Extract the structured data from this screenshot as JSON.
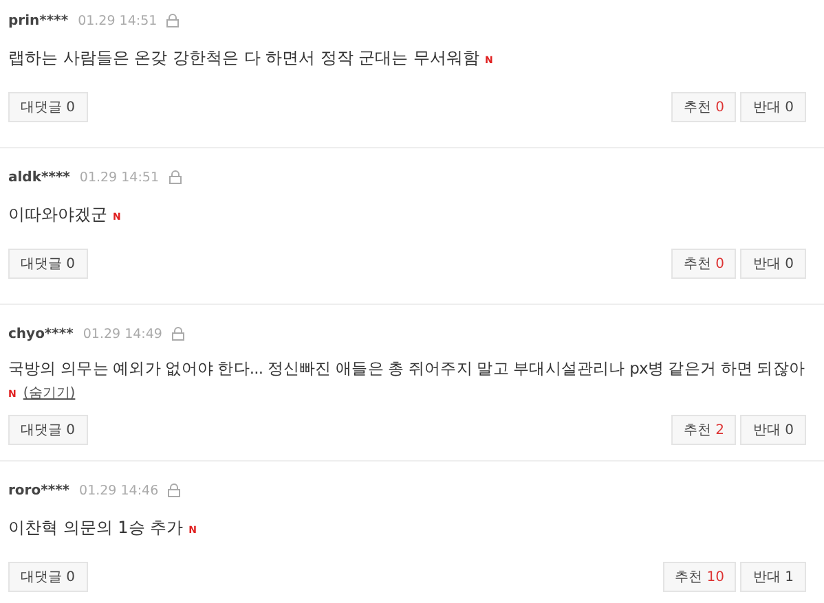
{
  "comments": [
    {
      "author": "prin****",
      "time": "01.29 14:51",
      "text": "랩하는 사람들은 온갖 강한척은 다 하면서 정작 군대는 무서워함",
      "new_badge": "N",
      "reply_label": "대댓글",
      "reply_count": "0",
      "up_label": "추천",
      "up_count": "0",
      "down_label": "반대",
      "down_count": "0"
    },
    {
      "author": "aldk****",
      "time": "01.29 14:51",
      "text": "이따와야겠군",
      "new_badge": "N",
      "reply_label": "대댓글",
      "reply_count": "0",
      "up_label": "추천",
      "up_count": "0",
      "down_label": "반대",
      "down_count": "0"
    },
    {
      "author": "chyo****",
      "time": "01.29 14:49",
      "text": "국방의 의무는 예외가 없어야 한다... 정신빠진 애들은 총 쥐어주지 말고 부대시설관리나 px병 같은거 하면 되잖아",
      "new_badge": "N",
      "hide_link": "(숨기기)",
      "reply_label": "대댓글",
      "reply_count": "0",
      "up_label": "추천",
      "up_count": "2",
      "down_label": "반대",
      "down_count": "0"
    },
    {
      "author": "roro****",
      "time": "01.29 14:46",
      "text": "이찬혁 의문의 1승 추가",
      "new_badge": "N",
      "reply_label": "대댓글",
      "reply_count": "0",
      "up_label": "추천",
      "up_count": "10",
      "down_label": "반대",
      "down_count": "1"
    }
  ]
}
